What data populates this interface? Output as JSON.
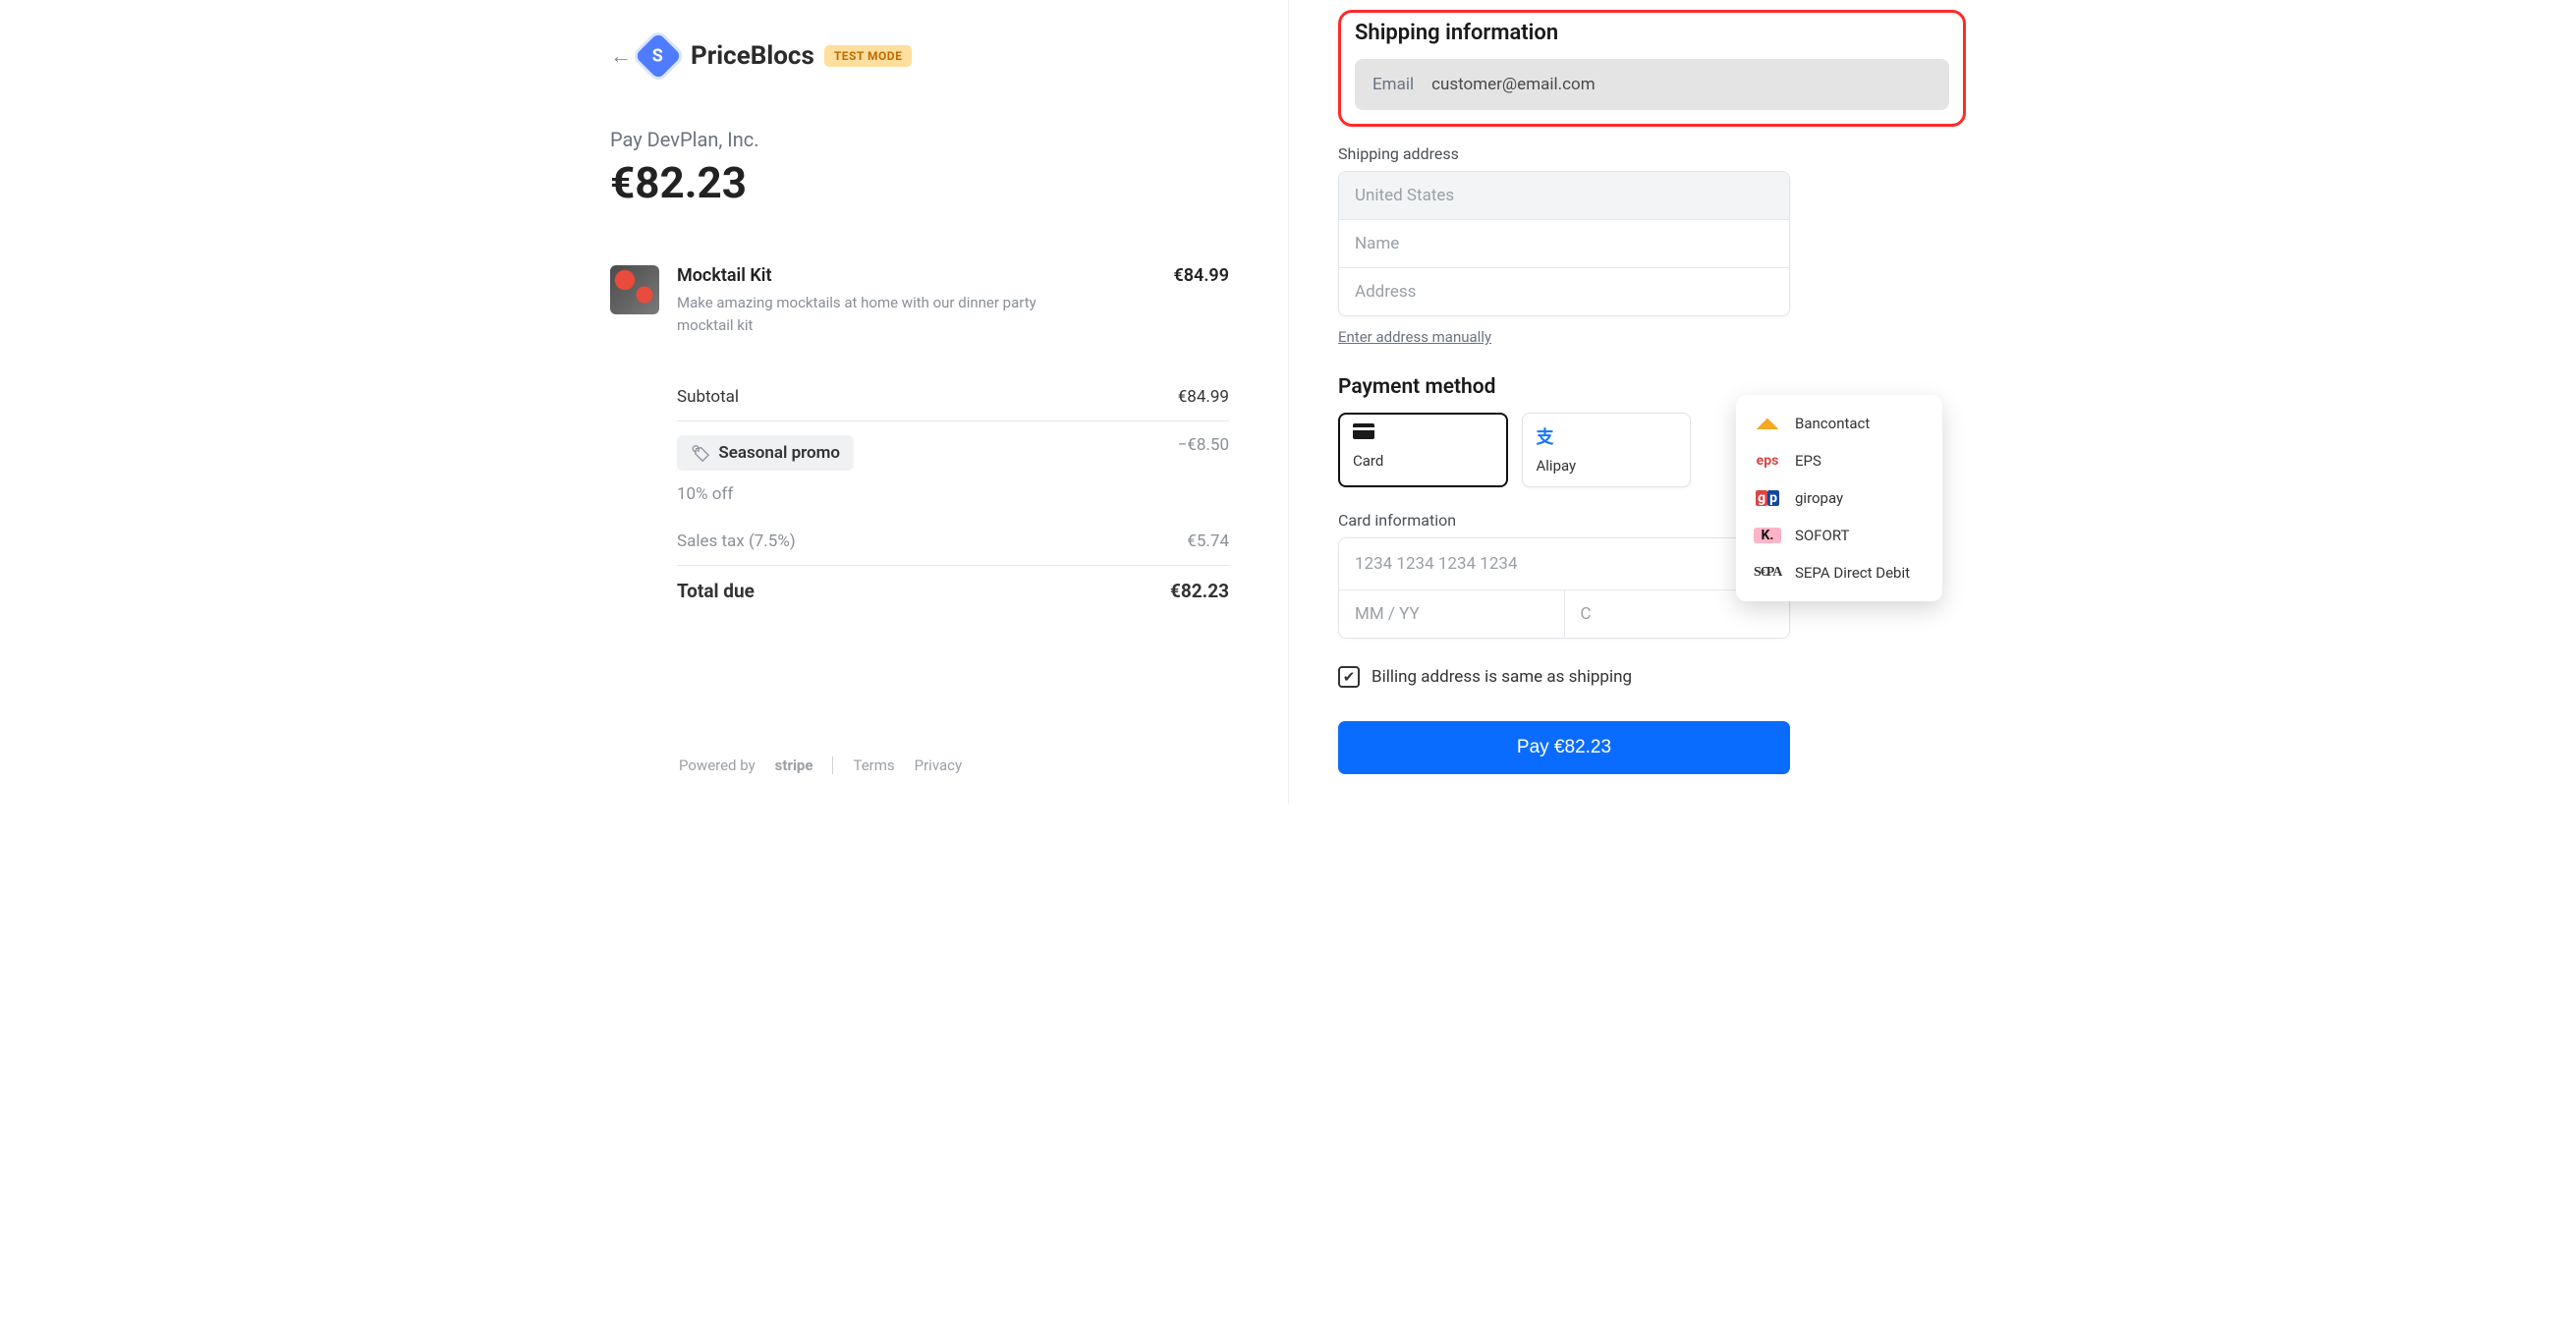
{
  "brand": {
    "name": "PriceBlocs",
    "badge": "TEST MODE"
  },
  "order": {
    "pay_to_label": "Pay DevPlan, Inc.",
    "amount": "€82.23",
    "item": {
      "title": "Mocktail Kit",
      "price": "€84.99",
      "description": "Make amazing mocktails at home with our dinner party mocktail kit"
    },
    "subtotal_label": "Subtotal",
    "subtotal_value": "€84.99",
    "promo": {
      "name": "Seasonal promo",
      "discount": "−€8.50",
      "note": "10% off"
    },
    "tax_label": "Sales tax (7.5%)",
    "tax_value": "€5.74",
    "total_label": "Total due",
    "total_value": "€82.23"
  },
  "footer": {
    "powered": "Powered by",
    "stripe": "stripe",
    "terms": "Terms",
    "privacy": "Privacy"
  },
  "shipping": {
    "title": "Shipping information",
    "email_label": "Email",
    "email_value": "customer@email.com",
    "address_label": "Shipping address",
    "country_placeholder": "United States",
    "name_placeholder": "Name",
    "address_placeholder": "Address",
    "manual_link": "Enter address manually"
  },
  "payment": {
    "title": "Payment method",
    "card_label": "Card",
    "alipay_label": "Alipay",
    "more_options": {
      "bancontact": "Bancontact",
      "eps": "EPS",
      "giropay": "giropay",
      "sofort": "SOFORT",
      "sepa": "SEPA Direct Debit"
    },
    "card_info_label": "Card information",
    "card_number_placeholder": "1234 1234 1234 1234",
    "exp_placeholder": "MM / YY",
    "cvc_placeholder": "C",
    "billing_same_label": "Billing address is same as shipping",
    "pay_button": "Pay €82.23"
  }
}
